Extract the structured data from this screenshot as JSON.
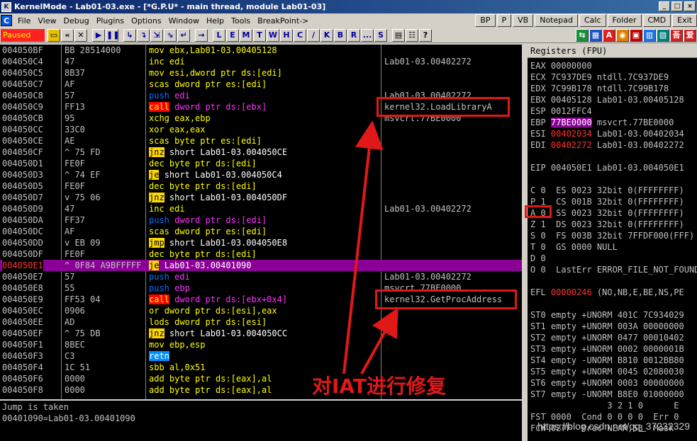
{
  "window": {
    "title": "KernelMode - Lab01-03.exe - [*G.P.U* - main thread, module Lab01-03]",
    "app_icon": "K"
  },
  "menu": {
    "icon": "C",
    "items": [
      "File",
      "View",
      "Debug",
      "Plugins",
      "Options",
      "Window",
      "Help",
      "Tools",
      "BreakPoint->"
    ],
    "right_buttons": [
      "BP",
      "P",
      "VB",
      "Notepad",
      "Calc",
      "Folder",
      "CMD",
      "Exit"
    ]
  },
  "toolbar": {
    "status": "Paused",
    "letters": [
      "L",
      "E",
      "M",
      "T",
      "W",
      "H",
      "C",
      "/",
      "K",
      "B",
      "R",
      "...",
      "S"
    ]
  },
  "disasm": {
    "rows": [
      {
        "addr": "004050BF",
        "hex": "BB 28514000",
        "op": "mov",
        "rest": "ebx,Lab01-03.00405128",
        "kind": "normal",
        "cmt": ""
      },
      {
        "addr": "004050C4",
        "hex": "47",
        "op": "inc",
        "rest": "edi",
        "kind": "normal",
        "cmt": "Lab01-03.00402272"
      },
      {
        "addr": "004050C5",
        "hex": "8B37",
        "op": "mov",
        "rest": "esi,dword ptr ds:[edi]",
        "kind": "normal",
        "cmt": ""
      },
      {
        "addr": "004050C7",
        "hex": "AF",
        "op": "scas",
        "rest": "dword ptr es:[edi]",
        "kind": "normal",
        "cmt": ""
      },
      {
        "addr": "004050C8",
        "hex": "57",
        "op": "push",
        "rest": "edi",
        "kind": "push",
        "cmt": "Lab01-03.00402272"
      },
      {
        "addr": "004050C9",
        "hex": "FF13",
        "op": "call",
        "rest": "dword ptr ds:[ebx]",
        "kind": "call",
        "cmt": "kernel32.LoadLibraryA"
      },
      {
        "addr": "004050CB",
        "hex": "95",
        "op": "xchg",
        "rest": "eax,ebp",
        "kind": "normal",
        "cmt": "msvcrt.77BE0000"
      },
      {
        "addr": "004050CC",
        "hex": "33C0",
        "op": "xor",
        "rest": "eax,eax",
        "kind": "normal",
        "cmt": ""
      },
      {
        "addr": "004050CE",
        "hex": "AE",
        "op": "scas",
        "rest": "byte ptr es:[edi]",
        "kind": "normal",
        "cmt": ""
      },
      {
        "addr": "004050CF",
        "hex": "^ 75 FD",
        "op": "jnz",
        "rest": "short Lab01-03.004050CE",
        "kind": "jcc",
        "cmt": ""
      },
      {
        "addr": "004050D1",
        "hex": "FE0F",
        "op": "dec",
        "rest": "byte ptr ds:[edi]",
        "kind": "normal",
        "cmt": ""
      },
      {
        "addr": "004050D3",
        "hex": "^ 74 EF",
        "op": "je",
        "rest": "short Lab01-03.004050C4",
        "kind": "jcc",
        "cmt": ""
      },
      {
        "addr": "004050D5",
        "hex": "FE0F",
        "op": "dec",
        "rest": "byte ptr ds:[edi]",
        "kind": "normal",
        "cmt": ""
      },
      {
        "addr": "004050D7",
        "hex": "v 75 06",
        "op": "jnz",
        "rest": "short Lab01-03.004050DF",
        "kind": "jcc",
        "cmt": ""
      },
      {
        "addr": "004050D9",
        "hex": "47",
        "op": "inc",
        "rest": "edi",
        "kind": "normal",
        "cmt": "Lab01-03.00402272"
      },
      {
        "addr": "004050DA",
        "hex": "FF37",
        "op": "push",
        "rest": "dword ptr ds:[edi]",
        "kind": "push",
        "cmt": ""
      },
      {
        "addr": "004050DC",
        "hex": "AF",
        "op": "scas",
        "rest": "dword ptr es:[edi]",
        "kind": "normal",
        "cmt": ""
      },
      {
        "addr": "004050DD",
        "hex": "v EB 09",
        "op": "jmp",
        "rest": "short Lab01-03.004050E8",
        "kind": "jcc",
        "cmt": ""
      },
      {
        "addr": "004050DF",
        "hex": "FE0F",
        "op": "dec",
        "rest": "byte ptr ds:[edi]",
        "kind": "normal",
        "cmt": ""
      },
      {
        "addr": "004050E1",
        "hex": "^ 0F84 A9BFFFFF",
        "op": "je",
        "rest": "Lab01-03.00401090",
        "kind": "current",
        "cmt": ""
      },
      {
        "addr": "004050E7",
        "hex": "57",
        "op": "push",
        "rest": "edi",
        "kind": "push",
        "cmt": "Lab01-03.00402272"
      },
      {
        "addr": "004050E8",
        "hex": "55",
        "op": "push",
        "rest": "ebp",
        "kind": "push",
        "cmt": "msvcrt.77BE0000"
      },
      {
        "addr": "004050E9",
        "hex": "FF53 04",
        "op": "call",
        "rest": "dword ptr ds:[ebx+0x4]",
        "kind": "call",
        "cmt": "kernel32.GetProcAddress"
      },
      {
        "addr": "004050EC",
        "hex": "0906",
        "op": "or",
        "rest": "dword ptr ds:[esi],eax",
        "kind": "normal",
        "cmt": ""
      },
      {
        "addr": "004050EE",
        "hex": "AD",
        "op": "lods",
        "rest": "dword ptr ds:[esi]",
        "kind": "normal",
        "cmt": ""
      },
      {
        "addr": "004050EF",
        "hex": "^ 75 DB",
        "op": "jnz",
        "rest": "short Lab01-03.004050CC",
        "kind": "jcc",
        "cmt": ""
      },
      {
        "addr": "004050F1",
        "hex": "8BEC",
        "op": "mov",
        "rest": "ebp,esp",
        "kind": "normal",
        "cmt": ""
      },
      {
        "addr": "004050F3",
        "hex": "C3",
        "op": "retn",
        "rest": "",
        "kind": "ret",
        "cmt": ""
      },
      {
        "addr": "004050F4",
        "hex": "1C 51",
        "op": "sbb",
        "rest": "al,0x51",
        "kind": "normal",
        "cmt": ""
      },
      {
        "addr": "004050F6",
        "hex": "0000",
        "op": "add",
        "rest": "byte ptr ds:[eax],al",
        "kind": "normal",
        "cmt": ""
      },
      {
        "addr": "004050F8",
        "hex": "0000",
        "op": "add",
        "rest": "byte ptr ds:[eax],al",
        "kind": "normal",
        "cmt": ""
      }
    ]
  },
  "info": {
    "line1": "Jump is taken",
    "line2": "00401090=Lab01-03.00401090"
  },
  "registers": {
    "header": "Registers (FPU)",
    "lines": [
      {
        "text": "EAX 00000000",
        "pre": "",
        "val": "",
        "post": "",
        "style": ""
      },
      {
        "text": "ECX 7C937DE9 ntdll.7C937DE9"
      },
      {
        "text": "EDX 7C99B178 ntdll.7C99B178"
      },
      {
        "text": "EBX 00405128 Lab01-03.00405128"
      },
      {
        "text": "ESP 0012FFC4"
      },
      {
        "pre": "EBP ",
        "val": "77BE0000",
        "post": " msvcrt.77BE0000",
        "style": "hl"
      },
      {
        "pre": "ESI ",
        "val": "00402034",
        "post": " Lab01-03.00402034",
        "style": "red"
      },
      {
        "pre": "EDI ",
        "val": "00402272",
        "post": " Lab01-03.00402272",
        "style": "red"
      },
      {
        "text": ""
      },
      {
        "text": "EIP 004050E1 Lab01-03.004050E1"
      },
      {
        "text": ""
      },
      {
        "text": "C 0  ES 0023 32bit 0(FFFFFFFF)"
      },
      {
        "text": "P 1  CS 001B 32bit 0(FFFFFFFF)"
      },
      {
        "text": "A 0  SS 0023 32bit 0(FFFFFFFF)"
      },
      {
        "text": "Z 1  DS 0023 32bit 0(FFFFFFFF)"
      },
      {
        "text": "S 0  FS 003B 32bit 7FFDF000(FFF)"
      },
      {
        "text": "T 0  GS 0000 NULL"
      },
      {
        "text": "D 0"
      },
      {
        "text": "O 0  LastErr ERROR_FILE_NOT_FOUND"
      },
      {
        "text": ""
      },
      {
        "pre": "EFL ",
        "val": "00000246",
        "post": " (NO,NB,E,BE,NS,PE",
        "style": "red"
      },
      {
        "text": ""
      },
      {
        "text": "ST0 empty +UNORM 401C 7C934029"
      },
      {
        "text": "ST1 empty +UNORM 003A 00000000"
      },
      {
        "text": "ST2 empty +UNORM 0477 00010402"
      },
      {
        "text": "ST3 empty +UNORM 0002 0000001B"
      },
      {
        "text": "ST4 empty -UNORM B810 0012BB80"
      },
      {
        "text": "ST5 empty +UNORM 0045 02080030"
      },
      {
        "text": "ST6 empty +UNORM 0003 00000000"
      },
      {
        "text": "ST7 empty -UNORM B8E0 01000000"
      },
      {
        "text": "               3 2 1 0      E"
      },
      {
        "text": "FST 0000  Cond 0 0 0 0  Err 0"
      },
      {
        "text": "FCW 027F  Prec NEAR,53  Mask"
      }
    ]
  },
  "annotation": {
    "caption": "对IAT进行修复"
  },
  "watermark": "https://blog.csdn.net/qq_37232329"
}
